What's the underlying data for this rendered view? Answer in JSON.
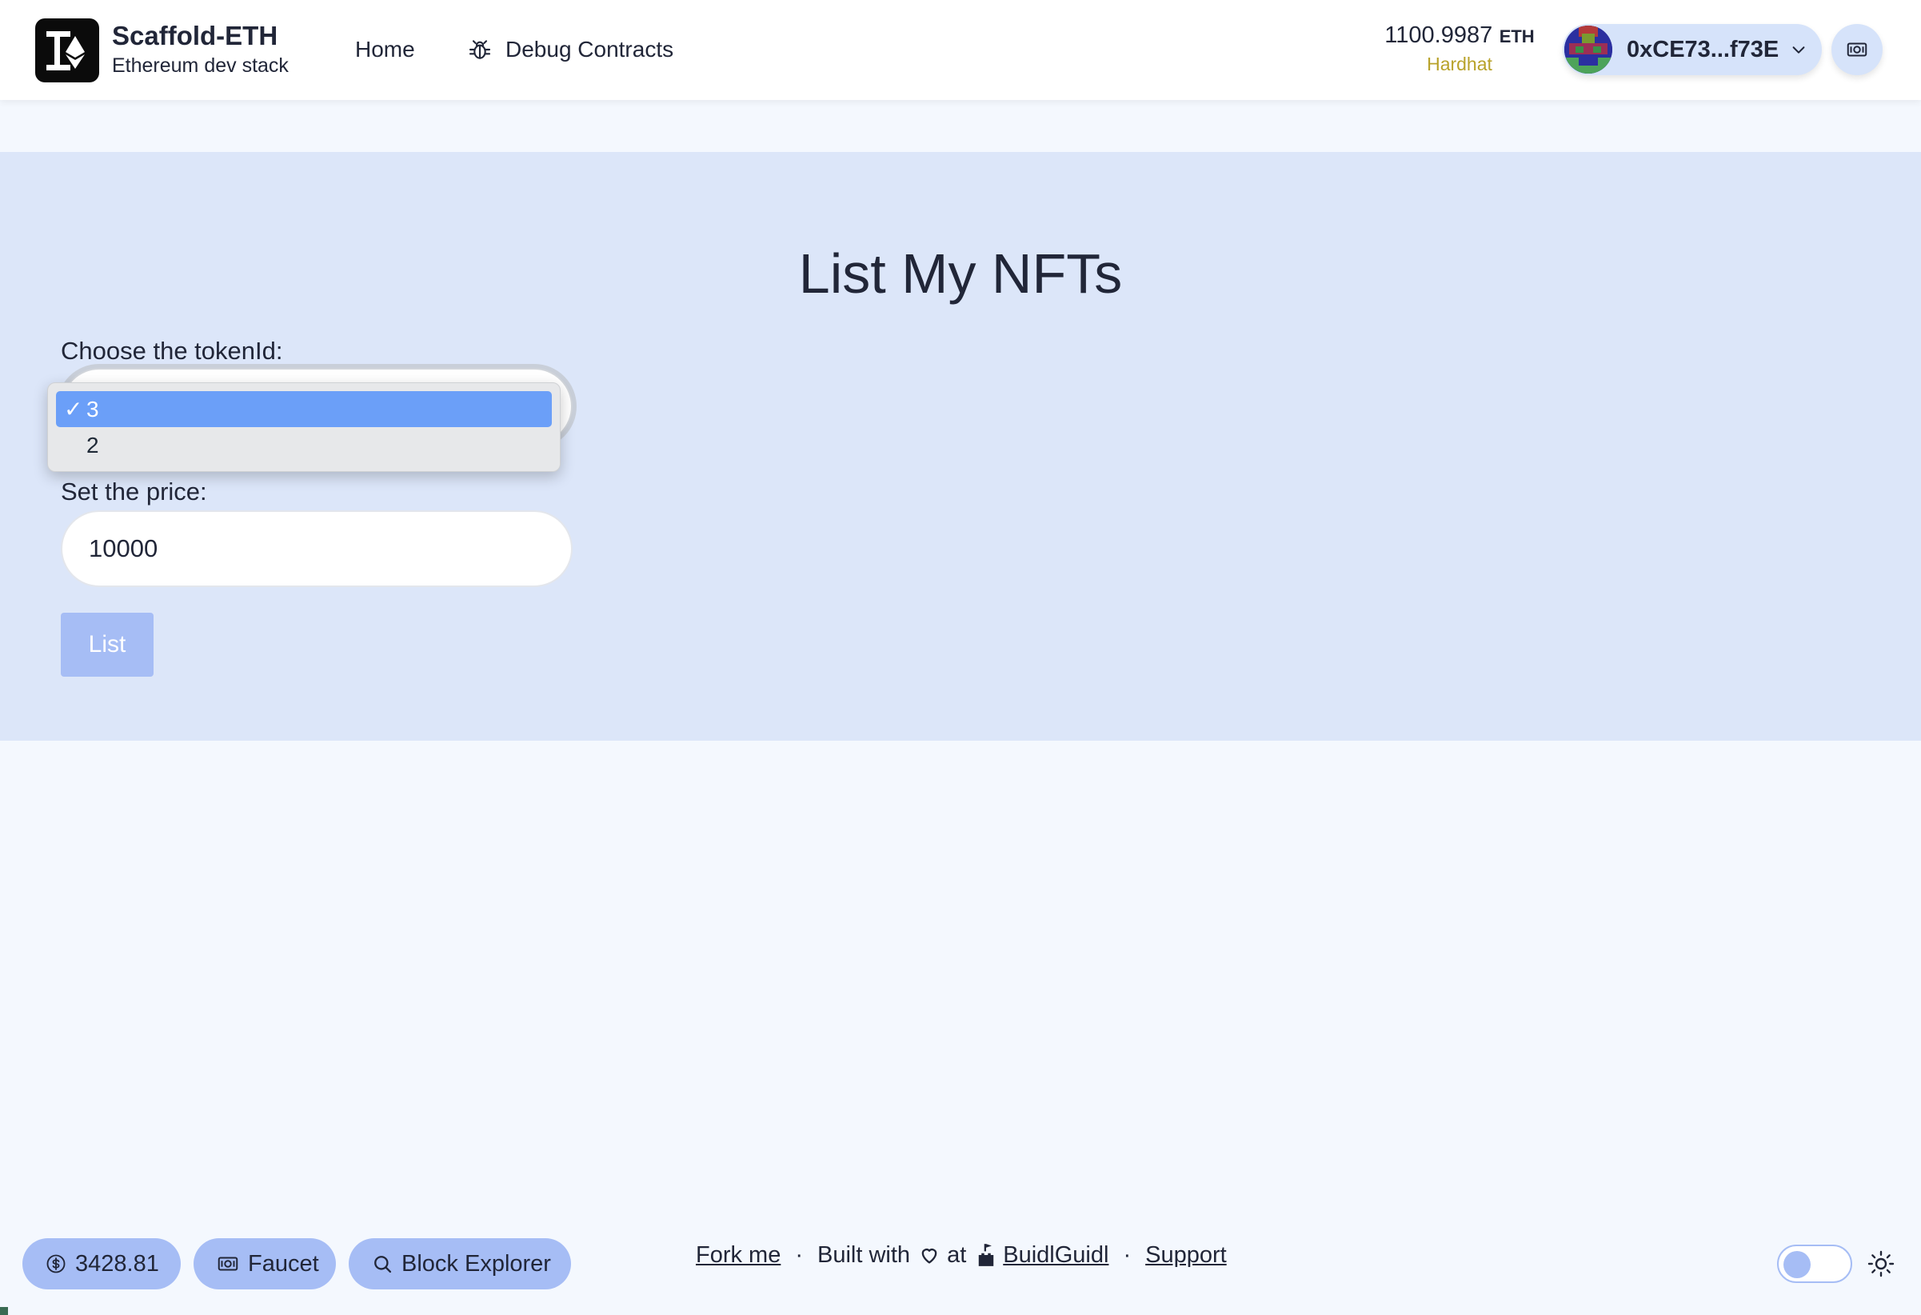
{
  "header": {
    "brand_title": "Scaffold-ETH",
    "brand_subtitle": "Ethereum dev stack",
    "nav": {
      "home": "Home",
      "debug": "Debug Contracts"
    },
    "balance": {
      "amount": "1100.9987",
      "unit": "ETH",
      "network": "Hardhat"
    },
    "account": {
      "address": "0xCE73...f73E"
    }
  },
  "main": {
    "title": "List My NFTs",
    "token_label": "Choose the tokenId:",
    "token_options": [
      "3",
      "2"
    ],
    "token_selected": "3",
    "check_mark": "✓",
    "price_label": "Set the price:",
    "price_value": "10000",
    "list_button": "List"
  },
  "footer": {
    "eth_price": "3428.81",
    "faucet": "Faucet",
    "block_explorer": "Block Explorer",
    "fork_me": "Fork me",
    "separator": "·",
    "built_with": "Built with",
    "at": "at",
    "buidlguidl": "BuidlGuidl",
    "support": "Support"
  },
  "icons": {
    "logo": "scaffold-eth-logo-icon",
    "debug": "bug-icon",
    "chevron": "chevron-down-icon",
    "qr": "qr-code-icon",
    "dollar": "dollar-circle-icon",
    "faucet": "banknote-icon",
    "explorer": "search-icon",
    "heart": "heart-icon",
    "buidlguidl": "castle-icon",
    "theme": "sun-icon"
  },
  "colors": {
    "background": "#f4f8fe",
    "band": "#dce6f9",
    "accent": "#a6bdf5",
    "selected_option": "#6b9ff8",
    "network": "#b8a22a"
  }
}
